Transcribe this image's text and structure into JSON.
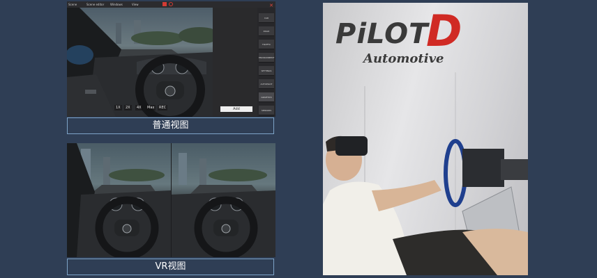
{
  "menubar": {
    "items": [
      "Scene",
      "Scene editor",
      "Windows",
      "View"
    ]
  },
  "sidebar": {
    "buttons": [
      "CAR",
      "ROAD",
      "TRAFFIC",
      "ENVIRONMENT",
      "SETTINGS",
      "AUTOPILOT",
      "GRAPHICS",
      "SENSORS"
    ]
  },
  "add_button": "Add",
  "zoom": {
    "items": [
      "1X",
      "2X",
      "4X",
      "Max",
      "REC"
    ]
  },
  "captions": {
    "normal_view": "普通视图",
    "vr_view": "VR视图"
  },
  "photo": {
    "logo_text": "PiLOT",
    "logo_d": "D",
    "logo_sub": "Automotive"
  },
  "colors": {
    "background": "#2f3e55",
    "caption_border": "#7ea4c8",
    "brand_red": "#d02a24"
  }
}
